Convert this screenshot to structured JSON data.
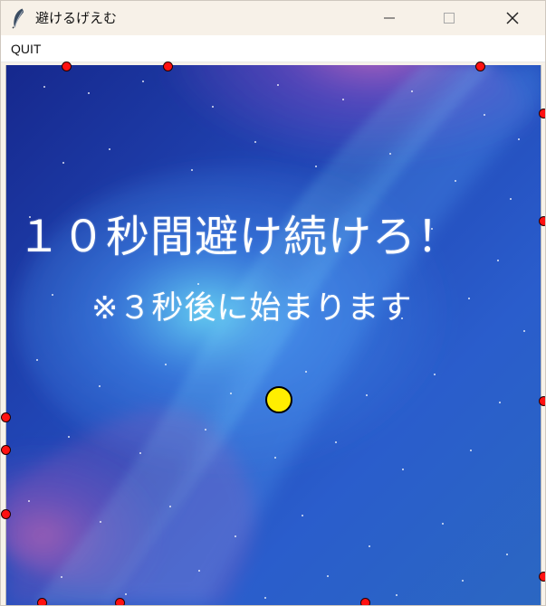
{
  "window": {
    "title": "避けるげえむ",
    "icon": "feather-icon"
  },
  "controls": {
    "minimize_icon": "minimize-icon",
    "maximize_icon": "maximize-icon",
    "close_icon": "close-icon"
  },
  "menu": {
    "quit_label": "QUIT"
  },
  "game": {
    "instruction_main": "１０秒間避け続けろ！",
    "instruction_sub": "※３秒後に始まります",
    "player_color": "#ffee00",
    "enemy_color": "#ff1111",
    "background_colors": {
      "deep_blue": "#132c89",
      "mid_blue": "#2450c6",
      "nebula_pink": "#d25aa6",
      "nebula_cyan": "#4fd1ff"
    }
  }
}
